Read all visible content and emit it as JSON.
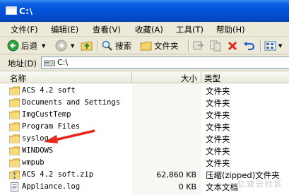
{
  "window": {
    "title": "C:\\"
  },
  "menu": [
    "文件(F)",
    "编辑(E)",
    "查看(V)",
    "收藏(A)",
    "工具(T)",
    "帮助(H)"
  ],
  "toolbar": {
    "back_label": "后退",
    "search_label": "搜索",
    "folders_label": "文件夹"
  },
  "address": {
    "label": "地址(D)",
    "path": "C:\\"
  },
  "columns": {
    "name": "名称",
    "size": "大小",
    "type": "类型"
  },
  "files": [
    {
      "name": "ACS 4.2 soft",
      "size": "",
      "type": "文件夹",
      "icon": "folder-icon"
    },
    {
      "name": "Documents and Settings",
      "size": "",
      "type": "文件夹",
      "icon": "folder-icon"
    },
    {
      "name": "ImgCustTemp",
      "size": "",
      "type": "文件夹",
      "icon": "folder-icon"
    },
    {
      "name": "Program Files",
      "size": "",
      "type": "文件夹",
      "icon": "folder-icon"
    },
    {
      "name": "syslog",
      "size": "",
      "type": "文件夹",
      "icon": "folder-icon"
    },
    {
      "name": "WINDOWS",
      "size": "",
      "type": "文件夹",
      "icon": "folder-icon"
    },
    {
      "name": "wmpub",
      "size": "",
      "type": "文件夹",
      "icon": "folder-icon"
    },
    {
      "name": "ACS 4.2 soft.zip",
      "size": "62,860 KB",
      "type": "压缩(zipped)文件夹",
      "icon": "zip-folder-icon"
    },
    {
      "name": "Appliance.log",
      "size": "0 KB",
      "type": "文本文档",
      "icon": "text-file-icon"
    }
  ],
  "annotation": {
    "color": "#e8261b",
    "target": "syslog"
  },
  "watermark": "亿速云社区"
}
